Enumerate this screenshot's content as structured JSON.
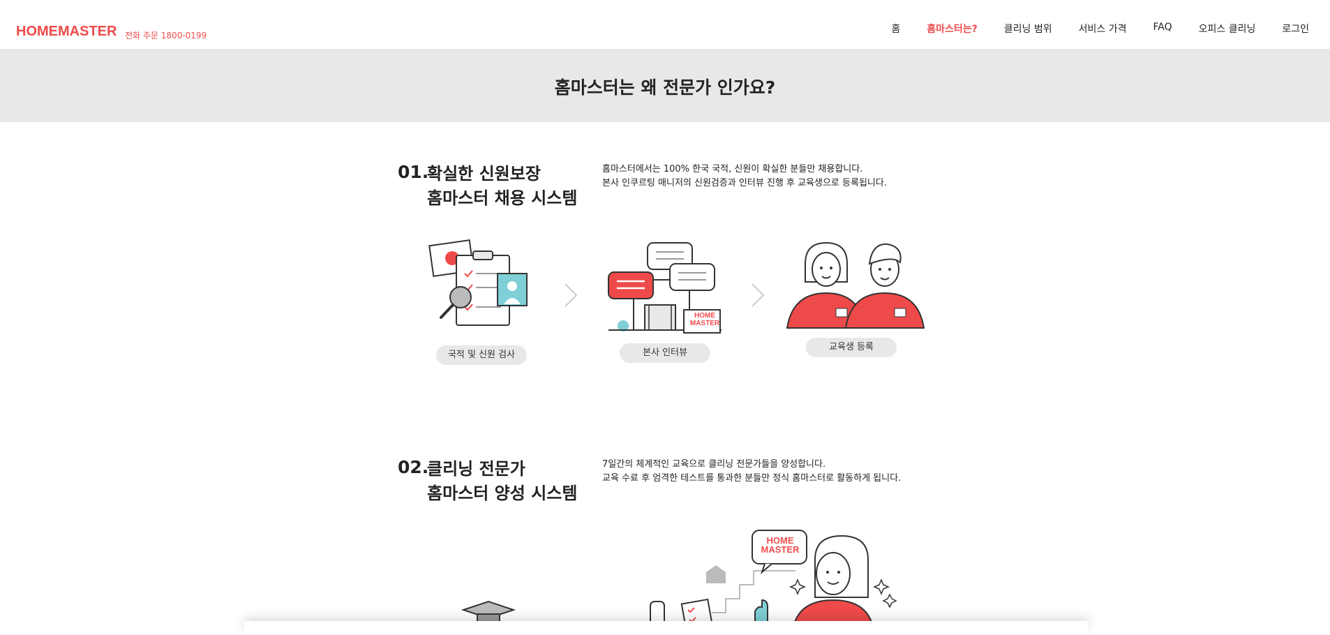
{
  "header": {
    "logo": "HOMEMASTER",
    "phone": "전화 주문 1800-0199",
    "nav": [
      {
        "label": "홈",
        "active": false
      },
      {
        "label": "홈마스터는?",
        "active": true
      },
      {
        "label": "클리닝 범위",
        "active": false
      },
      {
        "label": "서비스 가격",
        "active": false
      },
      {
        "label": "FAQ",
        "active": false
      },
      {
        "label": "오피스 클리닝",
        "active": false
      },
      {
        "label": "로그인",
        "active": false
      }
    ]
  },
  "banner": {
    "title": "홈마스터는 왜 전문가 인가요?"
  },
  "section1": {
    "number": "01.",
    "title_line1": "확실한 신원보장",
    "title_line2": "홈마스터 채용 시스템",
    "desc_line1": "홈마스터에서는 100% 한국 국적, 신원이 확실한 분들만 채용합니다.",
    "desc_line2": "본사 인쿠르팅 매니저의 신원검증과 인터뷰 진행 후 교육생으로 등록됩니다.",
    "steps": [
      {
        "label": "국적 및 신원 검사"
      },
      {
        "label": "본사 인터뷰"
      },
      {
        "label": "교육생 등록"
      }
    ],
    "badge_text": "HOME MASTER"
  },
  "section2": {
    "number": "02.",
    "title_line1": "클리닝 전문가",
    "title_line2": "홈마스터 양성 시스템",
    "desc_line1": "7일간의 체계적인 교육으로 클리닝 전문가들을 양성합니다.",
    "desc_line2": "교육 수료 후 엄격한 테스트를 통과한 분들만 정식 홈마스터로 활동하게 됩니다.",
    "bubble_text": "HOME MASTER"
  },
  "colors": {
    "accent": "#ef4a4a",
    "banner_bg": "#e8e8ea",
    "pill_bg": "#e8e8ea",
    "teal": "#7ecfd6"
  }
}
